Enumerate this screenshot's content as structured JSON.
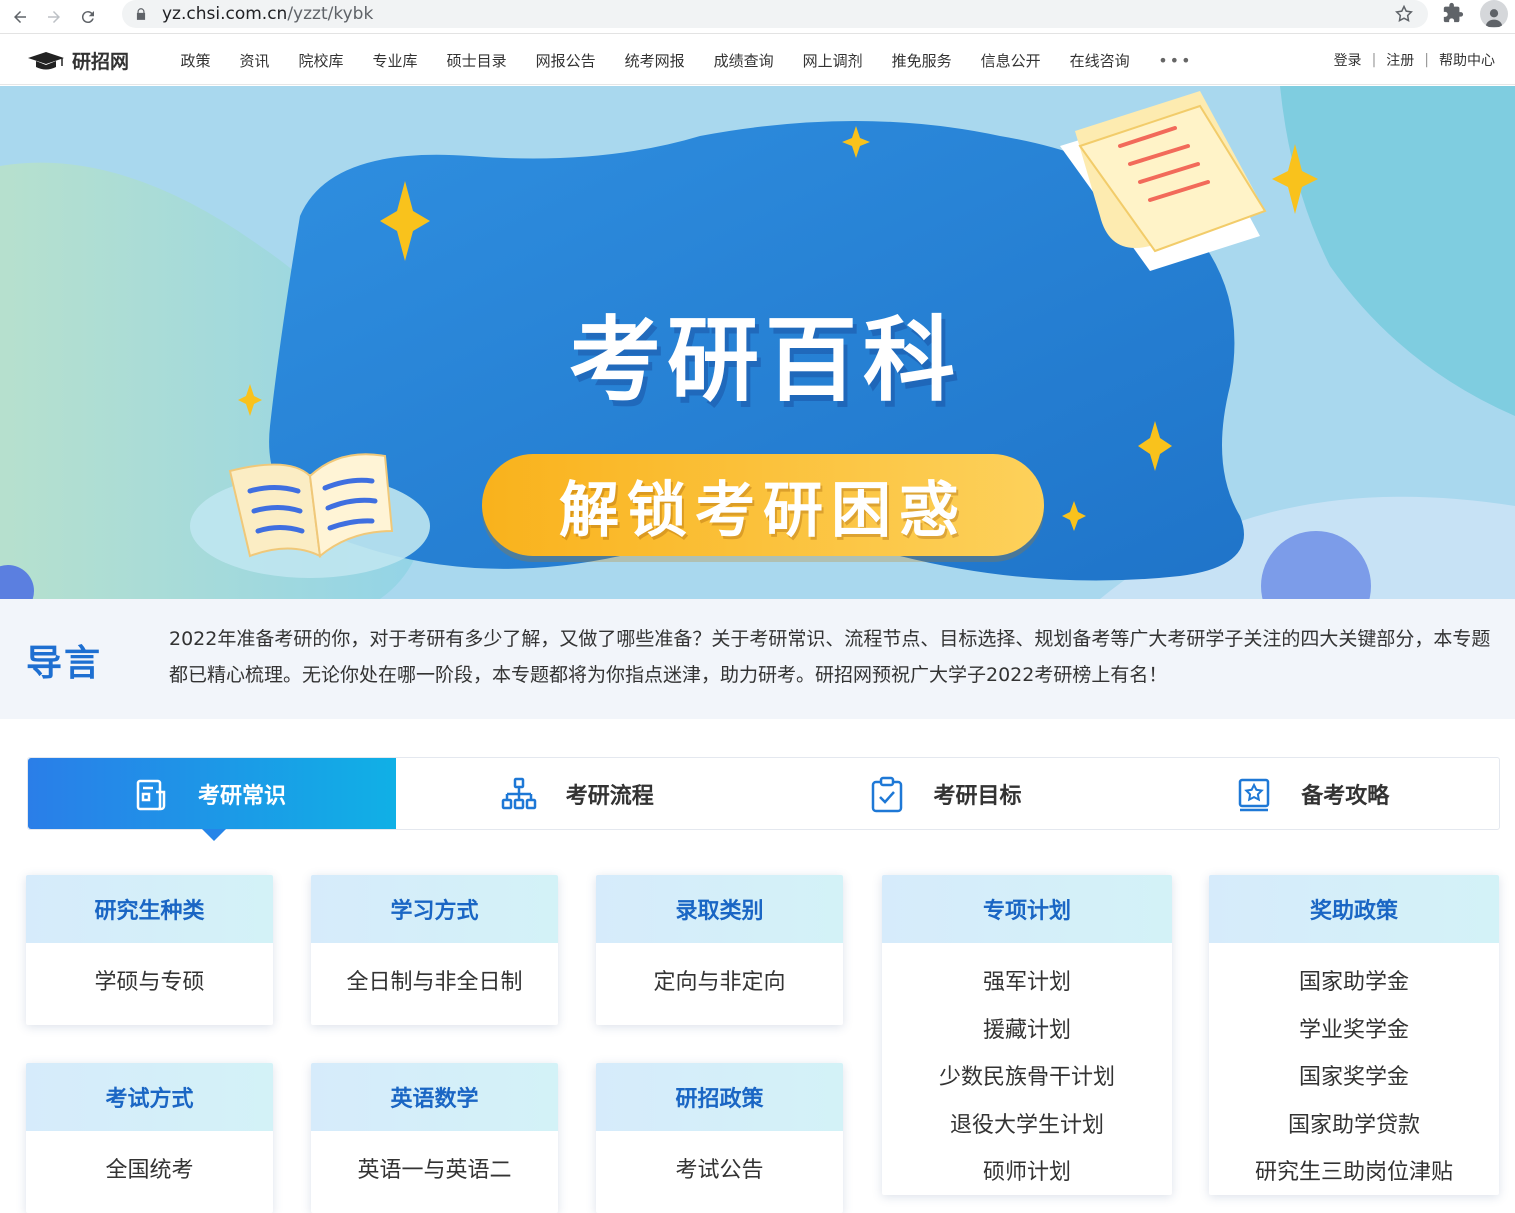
{
  "browser": {
    "url_host": "yz.chsi.com.cn",
    "url_path": "/yzzt/kybk"
  },
  "header": {
    "logo_text": "研招网",
    "nav": [
      "政策",
      "资讯",
      "院校库",
      "专业库",
      "硕士目录",
      "网报公告",
      "统考网报",
      "成绩查询",
      "网上调剂",
      "推免服务",
      "信息公开",
      "在线咨询"
    ],
    "more": "•••",
    "login": "登录",
    "register": "注册",
    "help": "帮助中心",
    "separator": "|"
  },
  "banner": {
    "title": "考研百科",
    "subtitle": "解锁考研困惑"
  },
  "intro": {
    "label": "导言",
    "text": "2022年准备考研的你，对于考研有多少了解，又做了哪些准备？关于考研常识、流程节点、目标选择、规划备考等广大考研学子关注的四大关键部分，本专题都已精心梳理。无论你处在哪一阶段，本专题都将为你指点迷津，助力研考。研招网预祝广大学子2022考研榜上有名！"
  },
  "tabs": [
    {
      "label": "考研常识",
      "icon": "document-icon",
      "active": true
    },
    {
      "label": "考研流程",
      "icon": "flowchart-icon",
      "active": false
    },
    {
      "label": "考研目标",
      "icon": "clipboard-check-icon",
      "active": false
    },
    {
      "label": "备考攻略",
      "icon": "star-book-icon",
      "active": false
    }
  ],
  "cards": [
    {
      "title": "研究生种类",
      "items": [
        "学硕与专硕"
      ]
    },
    {
      "title": "学习方式",
      "items": [
        "全日制与非全日制"
      ]
    },
    {
      "title": "录取类别",
      "items": [
        "定向与非定向"
      ]
    },
    {
      "title": "专项计划",
      "items": [
        "强军计划",
        "援藏计划",
        "少数民族骨干计划",
        "退役大学生计划",
        "硕师计划"
      ]
    },
    {
      "title": "奖助政策",
      "items": [
        "国家助学金",
        "学业奖学金",
        "国家奖学金",
        "国家助学贷款",
        "研究生三助岗位津贴"
      ]
    },
    {
      "title": "考试方式",
      "items": [
        "全国统考"
      ]
    },
    {
      "title": "英语数学",
      "items": [
        "英语一与英语二"
      ]
    },
    {
      "title": "研招政策",
      "items": [
        "考试公告"
      ]
    }
  ],
  "colors": {
    "primary": "#1e6fd1",
    "tab_active_start": "#2a7ee8",
    "tab_active_end": "#10b0e6",
    "card_head": "#d6ebfb",
    "banner_bg": "#a9d8ee",
    "pill": "#f9b21c"
  }
}
